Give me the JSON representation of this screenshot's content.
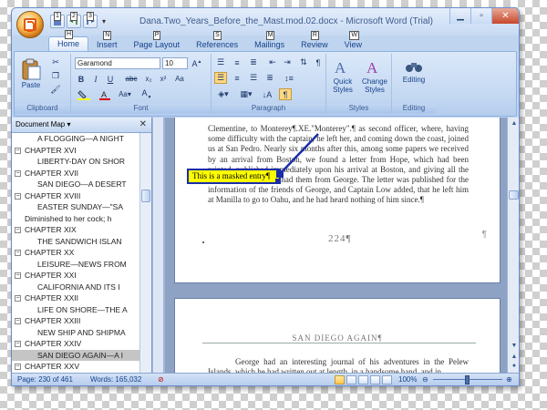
{
  "window": {
    "title": "Dana.Two_Years_Before_the_Mast.mod.02.docx - Microsoft Word (Trial)",
    "qat_keytips": [
      "1",
      "2",
      "3"
    ]
  },
  "tabs": [
    {
      "label": "Home",
      "keytip": "H",
      "active": true
    },
    {
      "label": "Insert",
      "keytip": "N",
      "active": false
    },
    {
      "label": "Page Layout",
      "keytip": "P",
      "active": false
    },
    {
      "label": "References",
      "keytip": "S",
      "active": false
    },
    {
      "label": "Mailings",
      "keytip": "M",
      "active": false
    },
    {
      "label": "Review",
      "keytip": "R",
      "active": false
    },
    {
      "label": "View",
      "keytip": "W",
      "active": false
    }
  ],
  "ribbon": {
    "clipboard": {
      "label": "Clipboard",
      "paste": "Paste"
    },
    "font": {
      "label": "Font",
      "family": "Garamond",
      "size": "10"
    },
    "paragraph": {
      "label": "Paragraph"
    },
    "styles": {
      "label": "Styles",
      "quick": "Quick",
      "quick2": "Styles",
      "change": "Change",
      "change2": "Styles"
    },
    "editing": {
      "label": "Editing"
    }
  },
  "docmap": {
    "title": "Document Map",
    "items": [
      {
        "text": "A FLOGGING—A NIGHT",
        "level": "l2",
        "pm": ""
      },
      {
        "text": "CHAPTER XVI",
        "level": "l1",
        "pm": "−"
      },
      {
        "text": "LIBERTY-DAY ON SHOR",
        "level": "l2",
        "pm": ""
      },
      {
        "text": "CHAPTER XVII",
        "level": "l1",
        "pm": "−"
      },
      {
        "text": "SAN DIEGO—A DESERT",
        "level": "l2",
        "pm": ""
      },
      {
        "text": "CHAPTER XVIII",
        "level": "l1",
        "pm": "−"
      },
      {
        "text": "EASTER SUNDAY—\"SA",
        "level": "l2",
        "pm": ""
      },
      {
        "text": "Diminished to her cock; h",
        "level": "l3",
        "pm": ""
      },
      {
        "text": "CHAPTER XIX",
        "level": "l1",
        "pm": "−"
      },
      {
        "text": "THE SANDWICH ISLAN",
        "level": "l2",
        "pm": ""
      },
      {
        "text": "CHAPTER XX",
        "level": "l1",
        "pm": "−"
      },
      {
        "text": "LEISURE—NEWS FROM",
        "level": "l2",
        "pm": ""
      },
      {
        "text": "CHAPTER XXI",
        "level": "l1",
        "pm": "−"
      },
      {
        "text": "CALIFORNIA AND ITS I",
        "level": "l2",
        "pm": ""
      },
      {
        "text": "CHAPTER XXII",
        "level": "l1",
        "pm": "−"
      },
      {
        "text": "LIFE ON SHORE—THE A",
        "level": "l2",
        "pm": ""
      },
      {
        "text": "CHAPTER XXIII",
        "level": "l1",
        "pm": "−"
      },
      {
        "text": "NEW SHIP AND SHIPMA",
        "level": "l2",
        "pm": ""
      },
      {
        "text": "CHAPTER XXIV",
        "level": "l1",
        "pm": "−"
      },
      {
        "text": "SAN DIEGO AGAIN—A I",
        "level": "l2",
        "pm": "",
        "selected": true
      },
      {
        "text": "CHAPTER XXV",
        "level": "l1",
        "pm": "−"
      }
    ]
  },
  "page1": {
    "paragraph": "Clementine, to Monterey¶.XE.\"Monterey\".¶ as second officer, where, having some difficulty with the captain, he left her, and coming down the coast, joined us at San Pedro. Nearly six months after this, among some papers we received by an arrival from Boston, we found a letter from Hope, which had been printed, published immediately upon his arrival at Boston, and giving all the particulars just as we had them from George. The letter was published for the information of the friends of George, and Captain Low added, that he left him at Manilla to go to Oahu, and he had heard nothing of him since.¶",
    "page_number": "224¶",
    "comment": "This is a masked entry¶"
  },
  "page2": {
    "heading": "SAN DIEGO AGAIN¶",
    "paragraph": "George had an interesting journal of his adventures in the Pelew Islands, which he had written out at length, in a handsome hand, and in"
  },
  "status": {
    "page": "Page: 230 of 461",
    "words": "Words: 165,032",
    "zoom": "100%"
  },
  "colors": {
    "accent": "#15428b",
    "comment_bg": "#ffff00",
    "comment_border": "#1a2ea8"
  }
}
